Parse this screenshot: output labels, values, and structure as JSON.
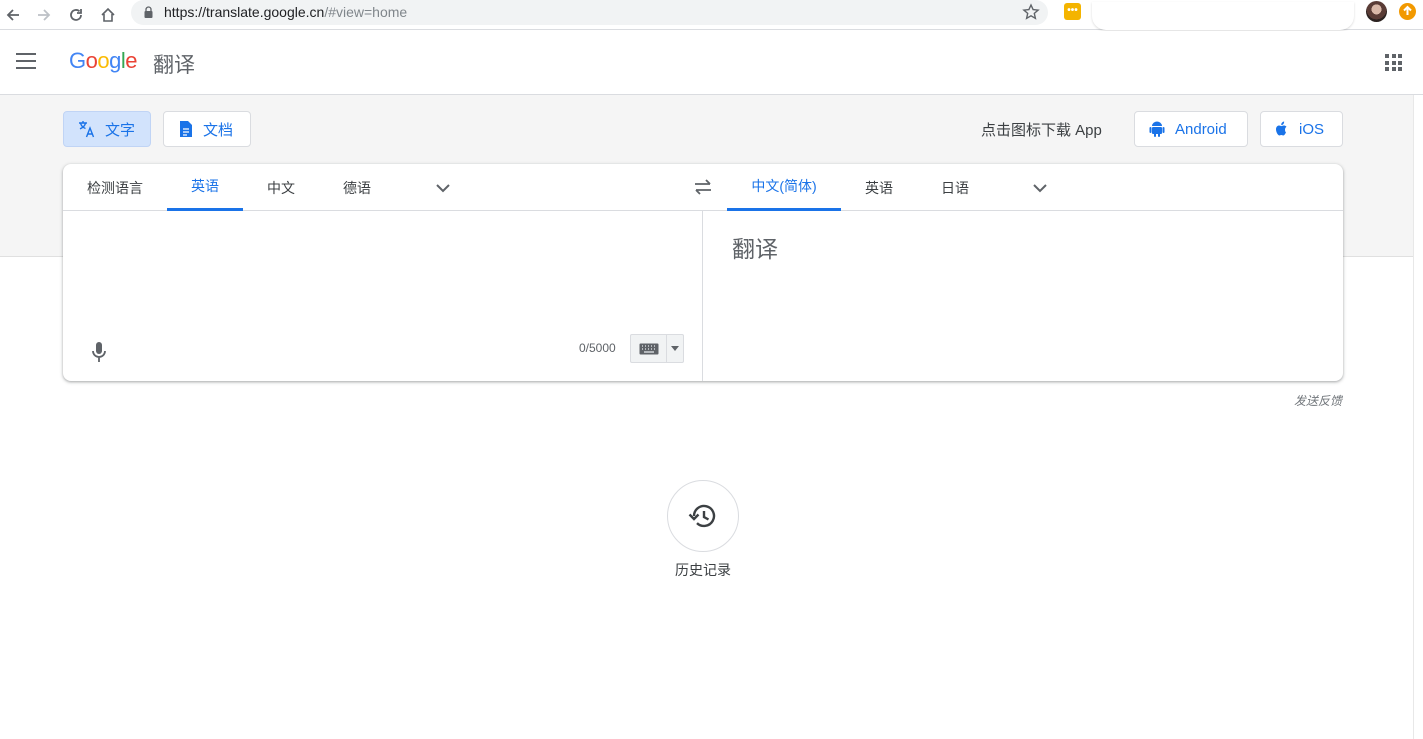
{
  "browser": {
    "url_host": "https://translate.google.cn",
    "url_path": "/#view=home",
    "yellow_ext_glyph": "•••"
  },
  "header": {
    "logo": [
      "G",
      "o",
      "o",
      "g",
      "l",
      "e"
    ],
    "product": "翻译"
  },
  "modes": {
    "text_label": "文字",
    "doc_label": "文档"
  },
  "download": {
    "prompt": "点击图标下载 App",
    "android_label": "Android",
    "ios_label": "iOS"
  },
  "source_langs": {
    "tabs": [
      "检测语言",
      "英语",
      "中文",
      "德语"
    ],
    "active": "英语"
  },
  "target_langs": {
    "tabs": [
      "中文(简体)",
      "英语",
      "日语"
    ],
    "active": "中文(简体)"
  },
  "source": {
    "counter": "0/5000"
  },
  "target": {
    "placeholder": "翻译"
  },
  "feedback": "发送反馈",
  "history": {
    "label": "历史记录"
  },
  "colors": {
    "accent": "#1a73e8",
    "band": "#f5f5f5",
    "mode_active_bg": "#d2e3fc"
  }
}
